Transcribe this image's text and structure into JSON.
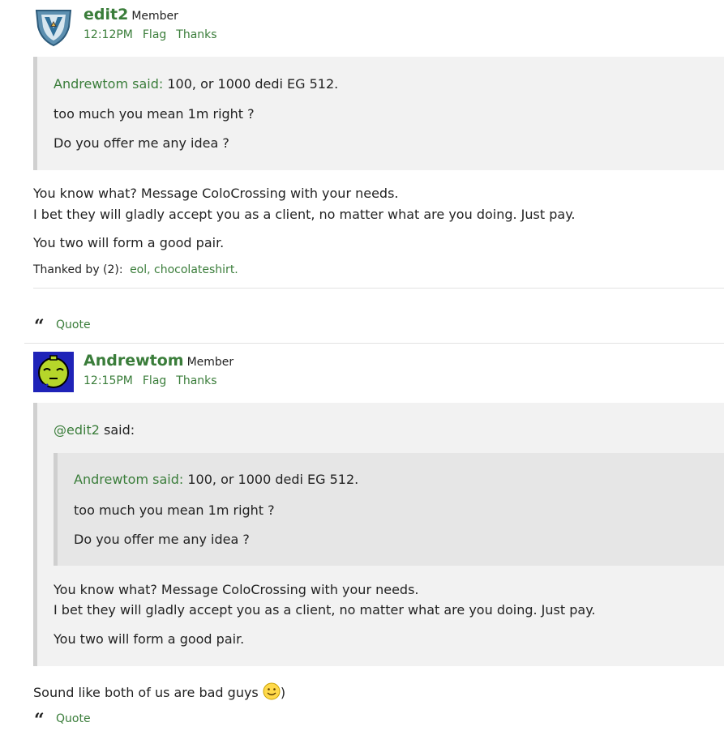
{
  "posts": [
    {
      "author": "edit2",
      "role": "Member",
      "time": "12:12PM",
      "flag_label": "Flag",
      "thanks_label": "Thanks",
      "quote": {
        "attribution": "Andrewtom said:",
        "first_line": "100, or 1000 dedi EG 512.",
        "lines": [
          "too much you mean 1m right ?",
          "Do you offer me any idea ?"
        ]
      },
      "body_lines": [
        "You know what? Message ColoCrossing with your needs.",
        "I bet they will gladly accept you as a client, no matter what are you doing. Just pay.",
        "You two will form a good pair."
      ],
      "thanked_label": "Thanked by (2):",
      "thanked_names": "eol, chocolateshirt.",
      "quote_action": "Quote"
    },
    {
      "author": "Andrewtom",
      "role": "Member",
      "time": "12:15PM",
      "flag_label": "Flag",
      "thanks_label": "Thanks",
      "quote": {
        "attribution": "@edit2",
        "said": "said:",
        "nested": {
          "attribution": "Andrewtom said:",
          "first_line": "100, or 1000 dedi EG 512.",
          "lines": [
            "too much you mean 1m right ?",
            "Do you offer me any idea ?"
          ]
        },
        "lines": [
          "You know what? Message ColoCrossing with your needs.",
          "I bet they will gladly accept you as a client, no matter what are you doing. Just pay.",
          "You two will form a good pair."
        ]
      },
      "body_text": "Sound like both of us are bad guys",
      "body_suffix": ")",
      "quote_action": "Quote"
    }
  ],
  "colors": {
    "link": "#3a7d3a",
    "quote_bg": "#f2f2f2",
    "nested_quote_bg": "#e6e6e6"
  },
  "icons": [
    "shield-avatar-icon",
    "frog-avatar-icon",
    "quote-icon",
    "smiley-icon"
  ]
}
